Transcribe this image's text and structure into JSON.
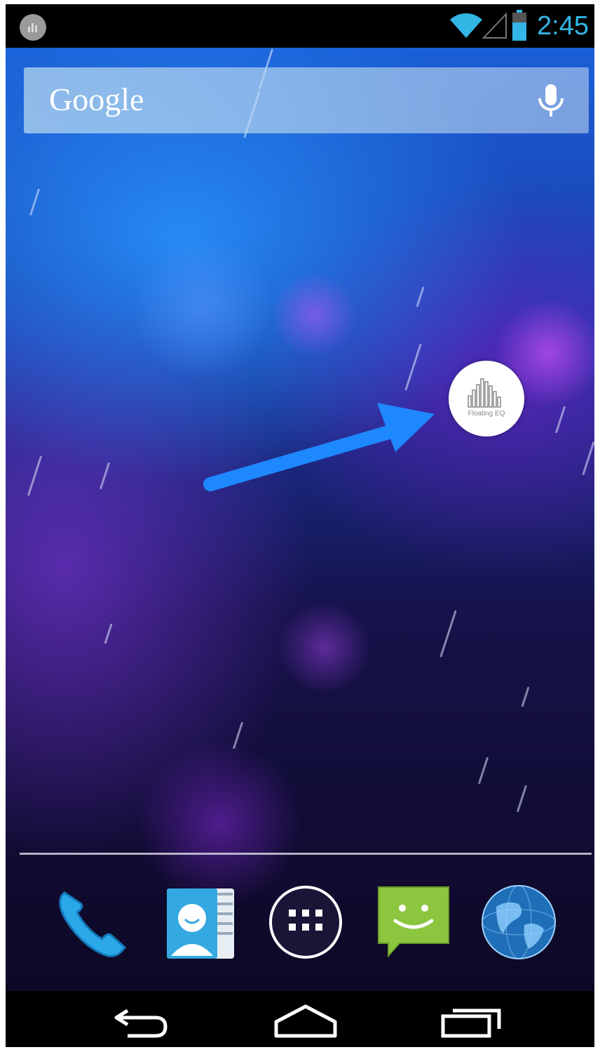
{
  "status_bar": {
    "time": "2:45",
    "notification_icon": "floating-eq-notification-icon",
    "wifi_icon": "wifi-icon",
    "signal_icon": "cell-signal-icon",
    "battery_icon": "battery-icon",
    "accent_color": "#33b5e5"
  },
  "search_widget": {
    "label": "Google",
    "mic_icon": "microphone-icon"
  },
  "floating_widget": {
    "label": "Floating EQ",
    "icon": "equalizer-icon"
  },
  "annotation": {
    "arrow_icon": "arrow-icon",
    "color": "#1e88ff"
  },
  "dock": {
    "items": [
      {
        "name": "Phone",
        "icon": "phone-icon"
      },
      {
        "name": "People",
        "icon": "contacts-icon"
      },
      {
        "name": "Apps",
        "icon": "app-drawer-icon"
      },
      {
        "name": "Messaging",
        "icon": "messaging-icon"
      },
      {
        "name": "Browser",
        "icon": "browser-globe-icon"
      }
    ]
  },
  "nav_bar": {
    "back_icon": "back-icon",
    "home_icon": "home-icon",
    "recents_icon": "recent-apps-icon"
  }
}
